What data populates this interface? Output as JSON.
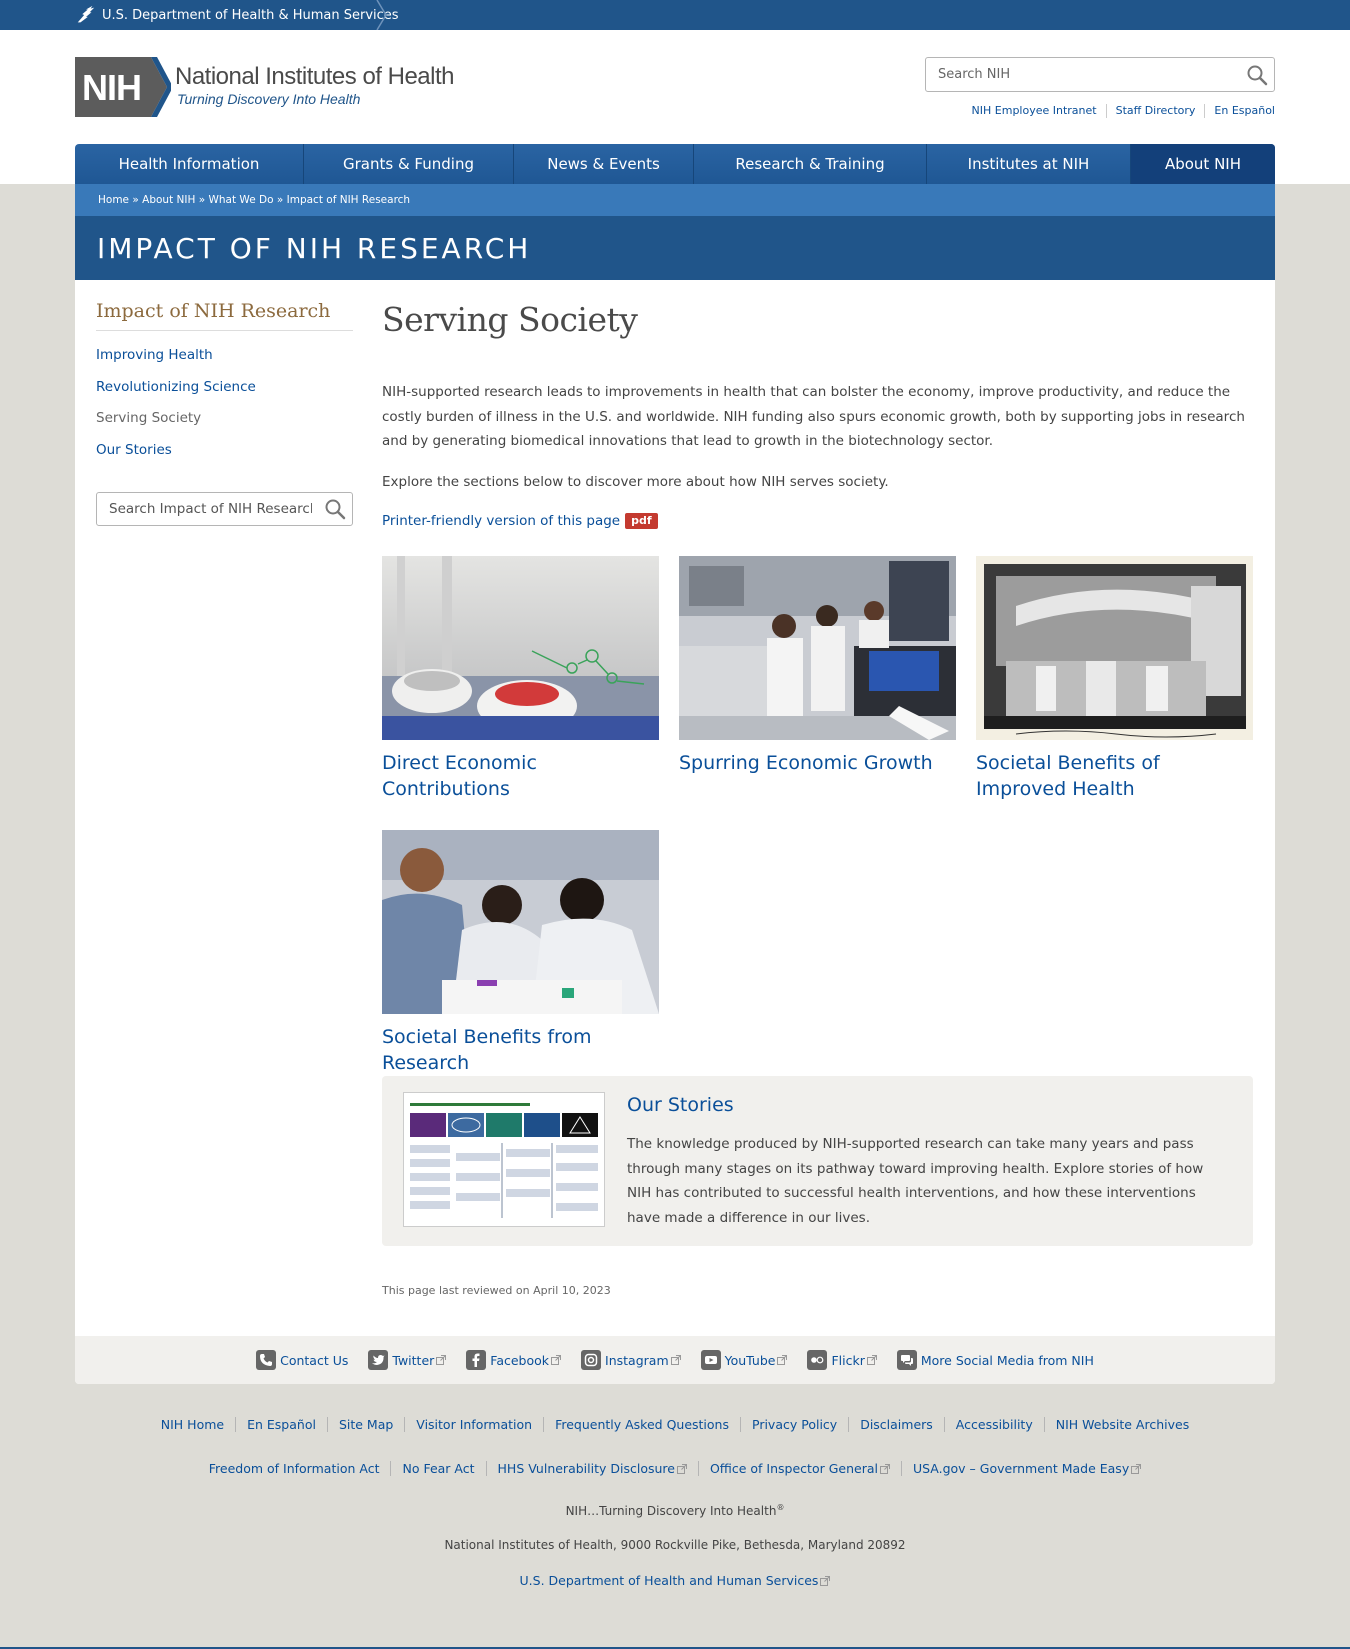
{
  "hhs": {
    "label": "U.S. Department of Health & Human Services"
  },
  "logo": {
    "mark": "NIH",
    "title": "National Institutes of Health",
    "tagline": "Turning Discovery Into Health"
  },
  "search": {
    "placeholder": "Search NIH"
  },
  "utility_links": [
    "NIH Employee Intranet",
    "Staff Directory",
    "En Español"
  ],
  "main_nav": [
    {
      "label": "Health Information"
    },
    {
      "label": "Grants & Funding"
    },
    {
      "label": "News & Events"
    },
    {
      "label": "Research & Training"
    },
    {
      "label": "Institutes at NIH"
    },
    {
      "label": "About NIH",
      "active": true
    }
  ],
  "breadcrumb": [
    "Home",
    "About NIH",
    "What We Do",
    "Impact of NIH Research"
  ],
  "breadcrumb_sep": "»",
  "section_title": "IMPACT OF NIH RESEARCH",
  "sidebar": {
    "title": "Impact of NIH Research",
    "items": [
      {
        "label": "Improving Health"
      },
      {
        "label": "Revolutionizing Science"
      },
      {
        "label": "Serving Society",
        "current": true
      },
      {
        "label": "Our Stories"
      }
    ],
    "search_placeholder": "Search Impact of NIH Research"
  },
  "page": {
    "title": "Serving Society",
    "intro": "NIH-supported research leads to improvements in health that can bolster the economy, improve productivity, and reduce the costly burden of illness in the U.S. and worldwide. NIH funding also spurs economic growth, both by supporting jobs in research and by generating biomedical innovations that lead to growth in the biotechnology sector.",
    "explore": "Explore the sections below to discover more about how NIH serves society.",
    "printer_link": "Printer-friendly version of this page",
    "pdf_badge": "pdf"
  },
  "cards": [
    {
      "title": "Direct Economic Contributions"
    },
    {
      "title": "Spurring Economic Growth"
    },
    {
      "title": "Societal Benefits of Improved Health"
    },
    {
      "title": "Societal Benefits from Research"
    }
  ],
  "stories": {
    "title": "Our Stories",
    "text": "The knowledge produced by NIH-supported research can take many years and pass through many stages on its pathway toward improving health. Explore stories of how NIH has contributed to successful health interventions, and how these interventions have made a difference in our lives."
  },
  "reviewed": "This page last reviewed on April 10, 2023",
  "social": [
    {
      "label": "Contact Us",
      "icon": "phone-icon"
    },
    {
      "label": "Twitter",
      "icon": "twitter-icon",
      "external": true
    },
    {
      "label": "Facebook",
      "icon": "facebook-icon",
      "external": true
    },
    {
      "label": "Instagram",
      "icon": "instagram-icon",
      "external": true
    },
    {
      "label": "YouTube",
      "icon": "youtube-icon",
      "external": true
    },
    {
      "label": "Flickr",
      "icon": "flickr-icon",
      "external": true
    },
    {
      "label": "More Social Media from NIH",
      "icon": "chat-icon"
    }
  ],
  "footer_links_1": [
    "NIH Home",
    "En Español",
    "Site Map",
    "Visitor Information",
    "Frequently Asked Questions",
    "Privacy Policy",
    "Disclaimers",
    "Accessibility",
    "NIH Website Archives"
  ],
  "footer_links_2": [
    {
      "label": "Freedom of Information Act"
    },
    {
      "label": "No Fear Act"
    },
    {
      "label": "HHS Vulnerability Disclosure",
      "external": true
    },
    {
      "label": "Office of Inspector General",
      "external": true
    },
    {
      "label": "USA.gov – Government Made Easy",
      "external": true
    }
  ],
  "footer": {
    "motto": "NIH…Turning Discovery Into Health",
    "motto_mark": "®",
    "address": "National Institutes of Health, 9000 Rockville Pike, Bethesda, Maryland 20892",
    "hhs_link": "U.S. Department of Health and Human Services"
  },
  "colors": {
    "primary": "#20558a",
    "breadcrumb": "#3979b9",
    "link": "#0a4f99",
    "sidebar_title": "#8c6a3e",
    "pdf": "#c43a30",
    "background": "#dddcd6"
  }
}
